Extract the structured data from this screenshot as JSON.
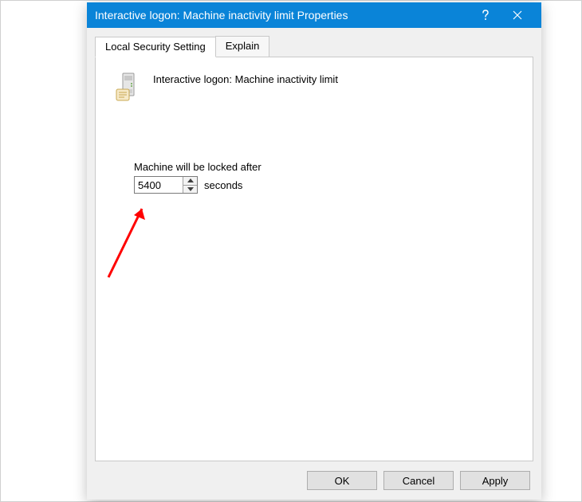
{
  "titlebar": {
    "title": "Interactive logon: Machine inactivity limit Properties"
  },
  "tabs": {
    "local_security": "Local Security Setting",
    "explain": "Explain"
  },
  "panel": {
    "policy_title": "Interactive logon: Machine inactivity limit",
    "field_label": "Machine will be locked after",
    "field_value": "5400",
    "unit": "seconds"
  },
  "buttons": {
    "ok": "OK",
    "cancel": "Cancel",
    "apply": "Apply"
  }
}
